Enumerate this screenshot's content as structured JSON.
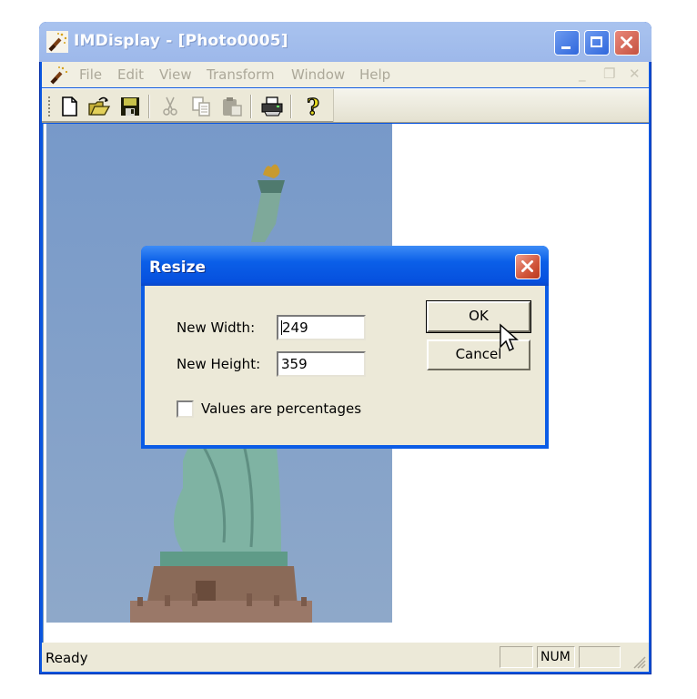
{
  "window": {
    "title": "IMDisplay - [Photo0005]",
    "icon": "imagemagick-wand-icon",
    "caption_buttons": [
      "minimize-icon",
      "maximize-icon",
      "close-icon"
    ]
  },
  "menubar": {
    "items": [
      {
        "label": "File"
      },
      {
        "label": "Edit"
      },
      {
        "label": "View"
      },
      {
        "label": "Transform"
      },
      {
        "label": "Window"
      },
      {
        "label": "Help"
      }
    ],
    "mdi_controls": {
      "minimize": "_",
      "restore": "❐",
      "close": "✕"
    }
  },
  "toolbar": {
    "buttons": [
      {
        "name": "new-file-icon",
        "enabled": true
      },
      {
        "name": "open-folder-icon",
        "enabled": true
      },
      {
        "name": "save-disk-icon",
        "enabled": true
      },
      {
        "name": "cut-scissors-icon",
        "enabled": false
      },
      {
        "name": "copy-icon",
        "enabled": false
      },
      {
        "name": "paste-clipboard-icon",
        "enabled": false
      },
      {
        "name": "print-icon",
        "enabled": true
      },
      {
        "name": "help-question-icon",
        "enabled": true
      }
    ]
  },
  "document": {
    "image_subject": "Statue of Liberty"
  },
  "statusbar": {
    "text": "Ready",
    "panes": [
      "",
      "NUM",
      ""
    ]
  },
  "dialog": {
    "title": "Resize",
    "fields": [
      {
        "label": "New Width:",
        "value": "249"
      },
      {
        "label": "New Height:",
        "value": "359"
      }
    ],
    "checkbox": {
      "label": "Values are percentages",
      "checked": false
    },
    "ok_label": "OK",
    "cancel_label": "Cancel"
  },
  "colors": {
    "xp_blue": "#0b5ce6",
    "inactive_title": "#a8c4f2",
    "face": "#ece9d8",
    "close_red": "#d1553b"
  }
}
